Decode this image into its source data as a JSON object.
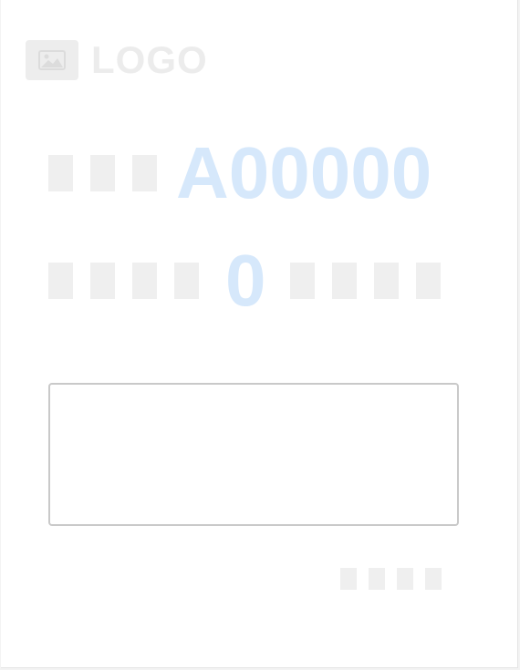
{
  "header": {
    "logo_text": "LOGO",
    "logo_icon": "image-icon"
  },
  "ticket": {
    "number": "A00000",
    "label_placeholder_count": 3
  },
  "queue": {
    "count": "0"
  },
  "input": {
    "value": "",
    "placeholder": ""
  },
  "colors": {
    "accent_light": "#d6e8fb",
    "placeholder_gray": "#efefef",
    "border": "#c9c9c9"
  }
}
